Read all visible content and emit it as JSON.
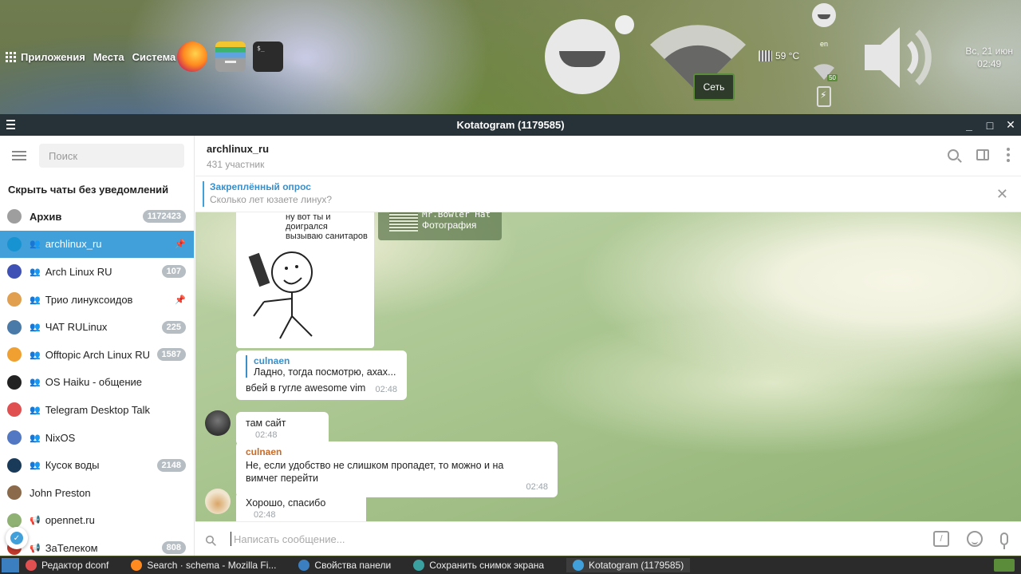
{
  "desktop": {
    "menu": [
      "Приложения",
      "Места",
      "Система"
    ],
    "terminal_prompt": "$_",
    "network_badge": "Сеть",
    "cpu_temp": "59 °C",
    "keyboard_layout": "en",
    "wifi_level": "50",
    "clock_date": "Вс, 21 июн",
    "clock_time": "02:49"
  },
  "window": {
    "title": "Kotatogram (1179585)",
    "controls": [
      "_",
      "□",
      "✕"
    ]
  },
  "sidebar": {
    "search_placeholder": "Поиск",
    "hide_muted": "Скрыть чаты без уведомлений",
    "chats": [
      {
        "name": "Архив",
        "badge": "1172423",
        "group": false,
        "pinned": false,
        "active": false,
        "bold": true,
        "color": "#9e9e9e"
      },
      {
        "name": "archlinux_ru",
        "badge": "",
        "group": true,
        "pinned": true,
        "active": true,
        "bold": false,
        "color": "#1793d1"
      },
      {
        "name": "Arch Linux RU",
        "badge": "107",
        "group": true,
        "pinned": false,
        "active": false,
        "bold": false,
        "color": "#3f51b5"
      },
      {
        "name": "Трио линуксоидов",
        "badge": "",
        "group": true,
        "pinned": true,
        "active": false,
        "bold": false,
        "color": "#e0a050"
      },
      {
        "name": "ЧАТ RULinux",
        "badge": "225",
        "group": true,
        "pinned": false,
        "active": false,
        "bold": false,
        "color": "#4a7aa8"
      },
      {
        "name": "Offtopic Arch Linux RU",
        "badge": "1587",
        "group": true,
        "pinned": false,
        "active": false,
        "bold": false,
        "color": "#f0a030"
      },
      {
        "name": "OS Haiku - общение",
        "badge": "",
        "group": true,
        "pinned": false,
        "active": false,
        "bold": false,
        "color": "#222222"
      },
      {
        "name": "Telegram Desktop Talk",
        "badge": "",
        "group": true,
        "pinned": false,
        "active": false,
        "bold": false,
        "color": "#e05050"
      },
      {
        "name": "NixOS",
        "badge": "",
        "group": true,
        "pinned": false,
        "active": false,
        "bold": false,
        "color": "#5277c3"
      },
      {
        "name": "Кусок воды",
        "badge": "2148",
        "group": true,
        "pinned": false,
        "active": false,
        "bold": false,
        "color": "#1a3a5a"
      },
      {
        "name": "John Preston",
        "badge": "",
        "group": false,
        "pinned": false,
        "active": false,
        "bold": false,
        "color": "#8a6a4a"
      },
      {
        "name": "opennet.ru",
        "badge": "",
        "group": false,
        "channel": true,
        "pinned": false,
        "active": false,
        "bold": false,
        "color": "#8fb173"
      },
      {
        "name": "ЗаТелеком",
        "badge": "808",
        "group": false,
        "channel": true,
        "pinned": false,
        "active": false,
        "bold": false,
        "color": "#c0392b"
      }
    ]
  },
  "chat": {
    "title": "archlinux_ru",
    "subtitle": "431 участник",
    "pinned_label": "Закреплённый опрос",
    "pinned_text": "Сколько лет юзаете линух?",
    "sticker_caption_1": "ну вот ты и доигрался",
    "sticker_caption_2": "вызываю санитаров",
    "reply_card_name": "Mr.Bowler Hat",
    "reply_card_type": "Фотография",
    "messages": [
      {
        "quote_name": "culnaen",
        "quote_text": "Ладно, тогда посмотрю, ахах...",
        "text": "вбей в гугле awesome vim",
        "time": "02:48"
      },
      {
        "text": "там сайт",
        "time": "02:48"
      },
      {
        "author": "culnaen",
        "text": "Не, если удобство не слишком пропадет, то можно и на вимчег перейти",
        "time": "02:48"
      },
      {
        "text": "Хорошо, спасибо",
        "time": "02:48"
      }
    ],
    "input_placeholder": "Написать сообщение...",
    "command_icon_label": "/"
  },
  "taskbar": {
    "tasks": [
      {
        "label": "Редактор dconf",
        "color": "#e05050"
      },
      {
        "label": "Search · schema - Mozilla Fi...",
        "color": "#ff8a1f"
      },
      {
        "label": "Свойства панели",
        "color": "#3c7fc0"
      },
      {
        "label": "Сохранить снимок экрана",
        "color": "#3aa0a0"
      },
      {
        "label": "Kotatogram (1179585)",
        "color": "#419fd9"
      }
    ]
  },
  "colors": {
    "accent": "#419fd9",
    "titlebar": "#263238",
    "author": "#c96c2a"
  }
}
